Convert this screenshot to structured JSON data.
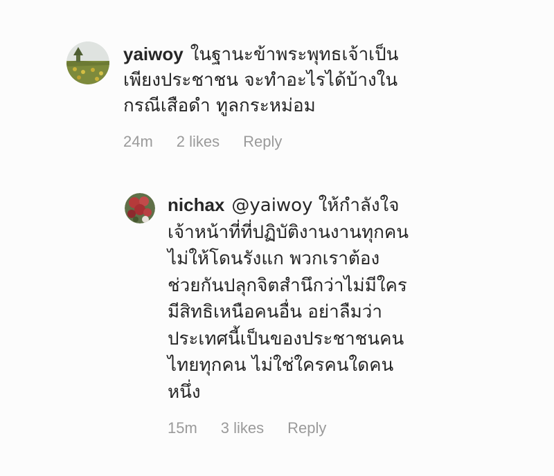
{
  "comments": [
    {
      "username": "yaiwoy",
      "lines": [
        "ในฐานะข้าพระพุทธเจ้าเป็น",
        "เพียงประชาชน จะทำอะไรได้บ้างใน",
        "กรณีเสือดำ ทูลกระหม่อม"
      ],
      "time": "24m",
      "likes": "2 likes",
      "reply_label": "Reply",
      "avatar_icon": "landscape-photo-avatar"
    },
    {
      "username": "nichax",
      "lines": [
        "@yaiwoy ให้กำลังใจ",
        "เจ้าหน้าที่ที่ปฏิบัติงานงานทุกคน",
        "ไม่ให้โดนรังแก พวกเราต้อง",
        "ช่วยกันปลุกจิตสำนึกว่าไม่มีใคร",
        "มีสิทธิเหนือคนอื่น อย่าลืมว่า",
        "ประเทศนี้เป็นของประชาชนคน",
        "ไทยทุกคน ไม่ใช่ใครคนใดคน",
        "หนึ่ง"
      ],
      "time": "15m",
      "likes": "3 likes",
      "reply_label": "Reply",
      "avatar_icon": "flowers-photo-avatar"
    }
  ]
}
